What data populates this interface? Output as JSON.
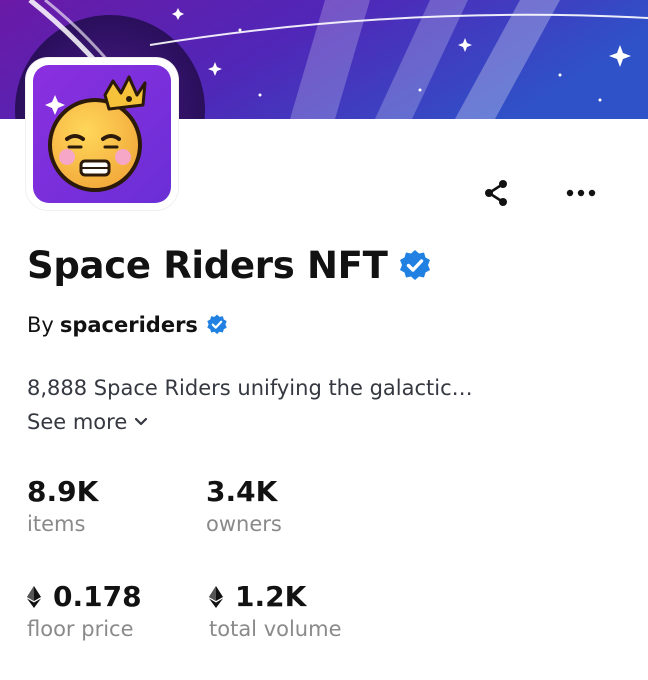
{
  "collection": {
    "name": "Space Riders NFT",
    "by_prefix": "By",
    "creator": "spaceriders",
    "description": "8,888 Space Riders unifying the galactic…",
    "see_more": "See more"
  },
  "icons": {
    "share": "share-icon",
    "more": "more-icon",
    "verified": "verified-badge-icon",
    "chevron": "chevron-down-icon",
    "eth": "ethereum-icon"
  },
  "stats": {
    "items": {
      "value": "8.9K",
      "label": "items"
    },
    "owners": {
      "value": "3.4K",
      "label": "owners"
    },
    "floor_price": {
      "value": "0.178",
      "label": "floor price"
    },
    "total_volume": {
      "value": "1.2K",
      "label": "total volume"
    }
  },
  "colors": {
    "banner_gradient_start": "#6d1fa8",
    "banner_gradient_end": "#2f4ec8",
    "avatar_bg": "#7a2bdc",
    "verified_blue": "#2081e2",
    "label_gray": "#8a8a8a"
  }
}
